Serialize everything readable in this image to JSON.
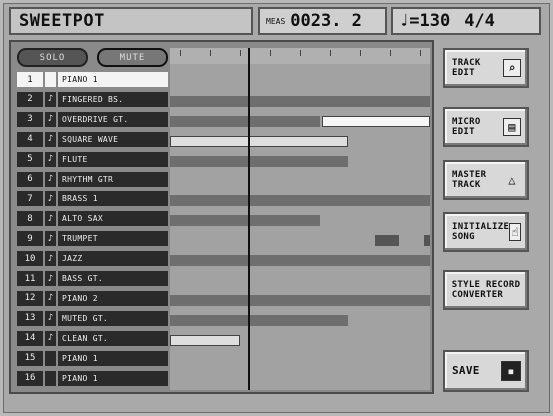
{
  "header": {
    "song_name": "SWEETPOT",
    "meas_label": "MEAS",
    "meas_value": "0023. 2",
    "tempo": "♩=130",
    "time_sig": "4/4"
  },
  "buttons": {
    "solo": "SOLO",
    "mute": "MUTE"
  },
  "tracks": [
    {
      "num": "1",
      "ind": "",
      "name": "PIANO 1",
      "selected": true
    },
    {
      "num": "2",
      "ind": "♪",
      "name": "FINGERED BS."
    },
    {
      "num": "3",
      "ind": "♪",
      "name": "OVERDRIVE GT."
    },
    {
      "num": "4",
      "ind": "♪",
      "name": "SQUARE WAVE"
    },
    {
      "num": "5",
      "ind": "♪",
      "name": "FLUTE"
    },
    {
      "num": "6",
      "ind": "♪",
      "name": "RHYTHM GTR"
    },
    {
      "num": "7",
      "ind": "♪",
      "name": "BRASS 1"
    },
    {
      "num": "8",
      "ind": "♪",
      "name": "ALTO SAX"
    },
    {
      "num": "9",
      "ind": "♪",
      "name": "TRUMPET"
    },
    {
      "num": "10",
      "ind": "♪",
      "name": "JAZZ"
    },
    {
      "num": "11",
      "ind": "♪",
      "name": "BASS GT."
    },
    {
      "num": "12",
      "ind": "♪",
      "name": "PIANO 2"
    },
    {
      "num": "13",
      "ind": "♪",
      "name": "MUTED GT."
    },
    {
      "num": "14",
      "ind": "♪",
      "name": "CLEAN GT."
    },
    {
      "num": "15",
      "ind": "",
      "name": "PIANO 1"
    },
    {
      "num": "16",
      "ind": "",
      "name": "PIANO 1"
    }
  ],
  "side_buttons": {
    "track_edit": "TRACK\nEDIT",
    "micro_edit": "MICRO\nEDIT",
    "master_track": "MASTER\nTRACK",
    "initialize_song": "INITIALIZE\nSONG",
    "style_converter": "STYLE RECORD\nCONVERTER",
    "save": "SAVE"
  },
  "icons": {
    "track_edit": "magnifier-icon",
    "micro_edit": "micro-edit-icon",
    "master_track": "metronome-icon",
    "initialize_song": "hand-icon",
    "save": "floppy-disk-icon"
  }
}
